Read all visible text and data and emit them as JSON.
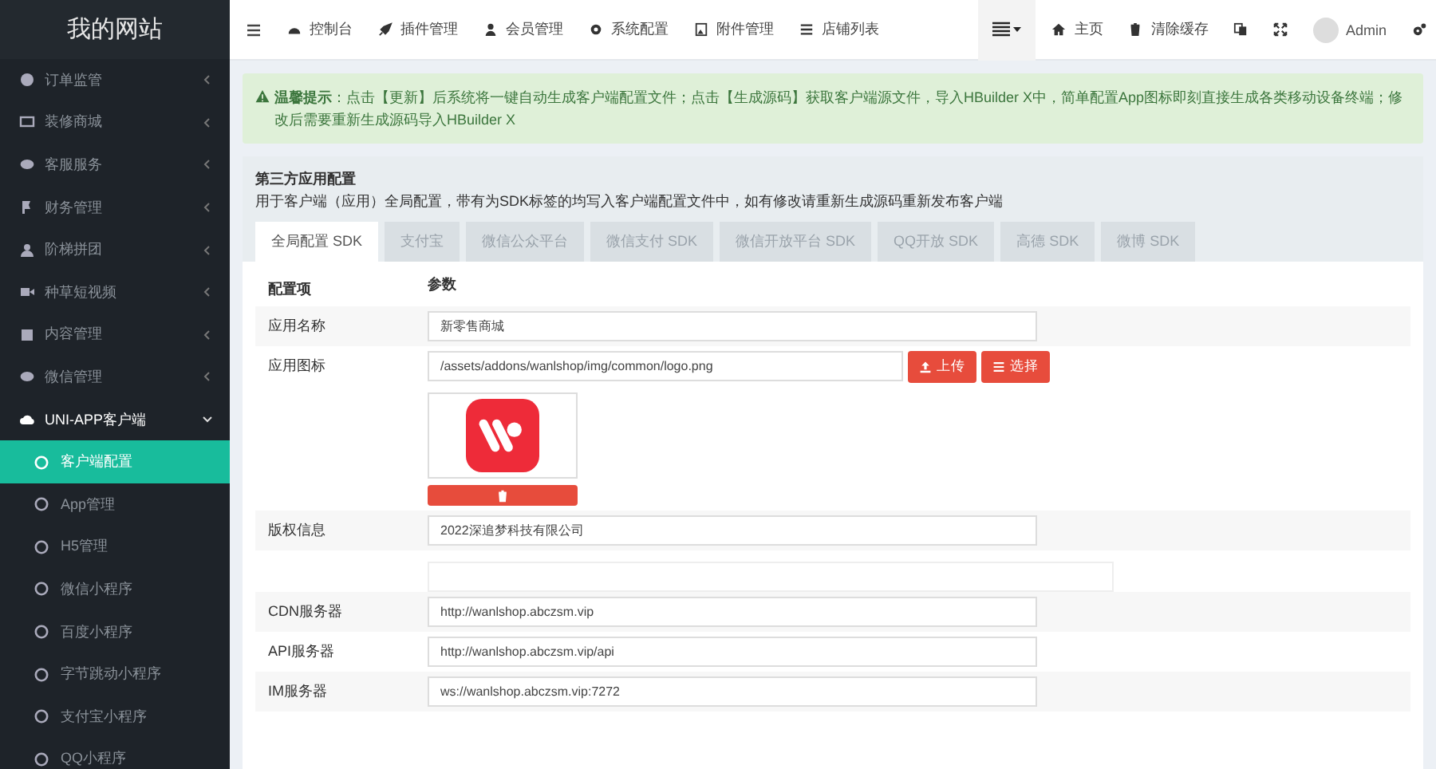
{
  "sidebar": {
    "title": "我的网站",
    "items": [
      {
        "label": "订单监管",
        "expanded": false
      },
      {
        "label": "装修商城",
        "expanded": false
      },
      {
        "label": "客服服务",
        "expanded": false
      },
      {
        "label": "财务管理",
        "expanded": false
      },
      {
        "label": "阶梯拼团",
        "expanded": false
      },
      {
        "label": "种草短视频",
        "expanded": false
      },
      {
        "label": "内容管理",
        "expanded": false
      },
      {
        "label": "微信管理",
        "expanded": false
      },
      {
        "label": "UNI-APP客户端",
        "expanded": true,
        "children": [
          {
            "label": "客户端配置",
            "selected": true
          },
          {
            "label": "App管理",
            "selected": false
          },
          {
            "label": "H5管理",
            "selected": false
          },
          {
            "label": "微信小程序",
            "selected": false
          },
          {
            "label": "百度小程序",
            "selected": false
          },
          {
            "label": "字节跳动小程序",
            "selected": false
          },
          {
            "label": "支付宝小程序",
            "selected": false
          },
          {
            "label": "QQ小程序",
            "selected": false
          }
        ]
      }
    ]
  },
  "topbar": {
    "nav": [
      {
        "label": "控制台"
      },
      {
        "label": "插件管理"
      },
      {
        "label": "会员管理"
      },
      {
        "label": "系统配置"
      },
      {
        "label": "附件管理"
      },
      {
        "label": "店铺列表"
      }
    ],
    "right": [
      {
        "label": "主页"
      },
      {
        "label": "清除缓存"
      }
    ],
    "user": "Admin"
  },
  "alert": "**温馨提示**：点击【更新】后系统将一键自动生成客户端配置文件；点击【生成源码】获取客户端源文件，导入HBuilder X中，简单配置App图标即刻直接生成各类移动设备终端；修改后需要重新生成源码导入HBuilder X",
  "panel": {
    "title": "第三方应用配置",
    "subtitle": "用于客户端（应用）全局配置，带有为SDK标签的均写入客户端配置文件中，如有修改请重新生成源码重新发布客户端",
    "tabs": [
      {
        "label": "全局配置 SDK",
        "selected": true
      },
      {
        "label": "支付宝",
        "selected": false
      },
      {
        "label": "微信公众平台",
        "selected": false
      },
      {
        "label": "微信支付 SDK",
        "selected": false
      },
      {
        "label": "微信开放平台 SDK",
        "selected": false
      },
      {
        "label": "QQ开放 SDK",
        "selected": false
      },
      {
        "label": "高德 SDK",
        "selected": false
      },
      {
        "label": "微博 SDK",
        "selected": false
      }
    ]
  },
  "form": {
    "columns": [
      "配置项",
      "参数"
    ],
    "rows": [
      {
        "kind": "text",
        "label": "应用名称",
        "value": "新零售商城"
      },
      {
        "kind": "image",
        "label": "应用图标",
        "value": "/assets/addons/wanlshop/img/common/logo.png",
        "buttons": [
          "上传",
          "选择"
        ]
      },
      {
        "kind": "text",
        "label": "版权信息",
        "value": "2022深追梦科技有限公司"
      },
      {
        "kind": "blank"
      },
      {
        "kind": "text",
        "label": "CDN服务器",
        "value": "http://wanlshop.abczsm.vip"
      },
      {
        "kind": "text",
        "label": "API服务器",
        "value": "http://wanlshop.abczsm.vip/api"
      },
      {
        "kind": "text",
        "label": "IM服务器",
        "value": "ws://wanlshop.abczsm.vip:7272"
      }
    ]
  }
}
